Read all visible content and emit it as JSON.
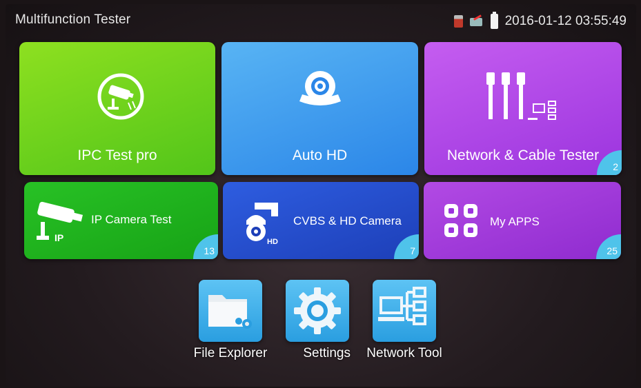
{
  "header": {
    "title": "Multifunction Tester",
    "datetime": "2016-01-12 03:55:49",
    "icons": [
      "sd-card-icon",
      "network-disconnected-icon",
      "battery-icon"
    ]
  },
  "tiles": {
    "ipc_test": {
      "label": "IPC Test pro",
      "icon": "cctv-camera-icon"
    },
    "auto_hd": {
      "label": "Auto HD",
      "icon": "dome-camera-icon"
    },
    "network_cable": {
      "label": "Network & Cable Tester",
      "icon": "cable-network-icon",
      "badge": "2"
    },
    "ip_camera": {
      "label": "IP Camera Test",
      "icon": "ip-camera-icon",
      "badge": "13"
    },
    "cvbs_hd": {
      "label": "CVBS & HD Camera",
      "icon": "ptz-camera-icon",
      "badge": "7"
    },
    "my_apps": {
      "label": "My APPS",
      "icon": "apps-icon",
      "badge": "25"
    }
  },
  "dock": {
    "file_explorer": {
      "label": "File Explorer",
      "icon": "folder-icon"
    },
    "settings": {
      "label": "Settings",
      "icon": "gear-icon"
    },
    "network_tool": {
      "label": "Network Tool",
      "icon": "network-tool-icon"
    }
  },
  "colors": {
    "green": "#52c51a",
    "blue": "#2b86e8",
    "purple": "#9b34de",
    "badge": "#4fc3ea"
  }
}
